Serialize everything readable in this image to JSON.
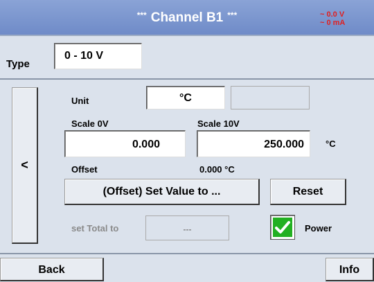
{
  "header": {
    "stars_left": "***",
    "title": "Channel B1",
    "stars_right": "***",
    "status_voltage": "~ 0.0 V",
    "status_current": "~ 0 mA"
  },
  "type": {
    "label": "Type",
    "value": "0 - 10 V"
  },
  "nav": {
    "prev_label": "<"
  },
  "unit": {
    "label": "Unit",
    "value": "°C",
    "secondary_value": ""
  },
  "scale": {
    "scale0_label": "Scale 0V",
    "scale10_label": "Scale 10V",
    "scale0_value": "0.000",
    "scale10_value": "250.000",
    "unit": "°C"
  },
  "offset": {
    "label": "Offset",
    "value": "0.000 °C"
  },
  "actions": {
    "set_offset_label": "(Offset) Set Value to ...",
    "reset_label": "Reset"
  },
  "total": {
    "label": "set Total to",
    "value": "---"
  },
  "power": {
    "label": "Power",
    "checked": true,
    "check_color": "#22b022"
  },
  "footer": {
    "back_label": "Back",
    "info_label": "Info"
  }
}
